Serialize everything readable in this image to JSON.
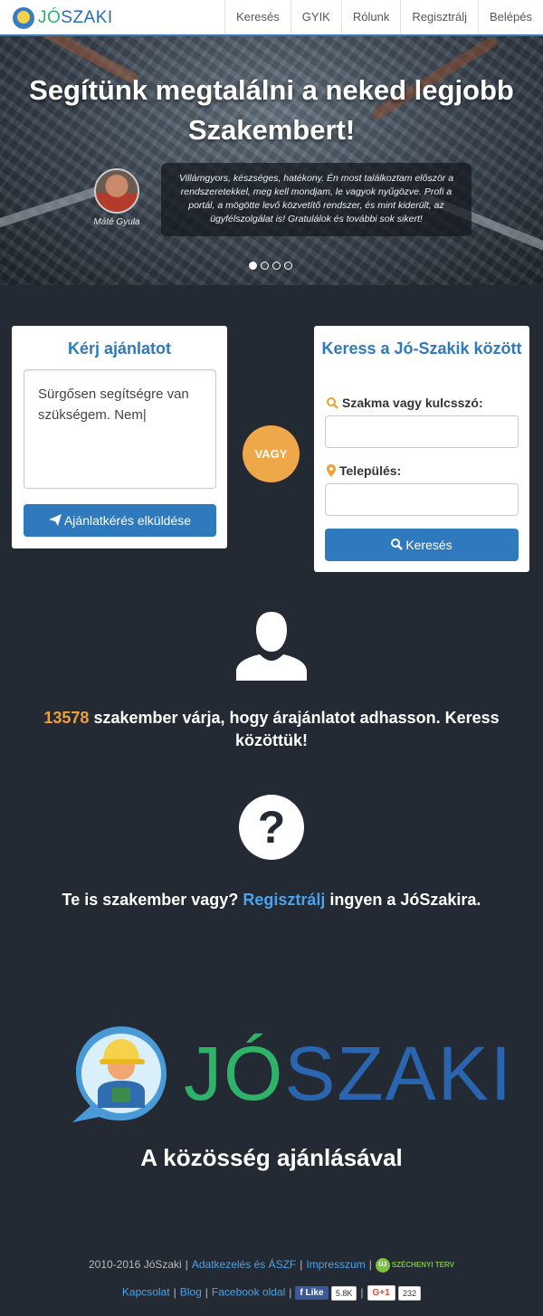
{
  "brand": {
    "jo": "JÓ",
    "szaki": "SZAKI"
  },
  "nav": {
    "items": [
      {
        "label": "Keresés"
      },
      {
        "label": "GYIK"
      },
      {
        "label": "Rólunk"
      },
      {
        "label": "Regisztrálj"
      },
      {
        "label": "Belépés"
      }
    ]
  },
  "hero": {
    "title": "Segítünk megtalálni a neked legjobb Szakembert!",
    "author": "Máté Gyula",
    "quote": "Villámgyors, készséges, hatékony. Én most találkoztam először a rendszeretekkel, meg kell mondjam, le vagyok nyűgözve. Profi a portál, a mögötte levő közvetítő rendszer, és mint kiderült, az ügyfélszolgálat is! Gratulálok és további sok sikert!",
    "slides_total": 4,
    "active_slide": 1
  },
  "request_card": {
    "title": "Kérj ajánlatot",
    "textarea_value": "Sürgősen segítségre van szükségem. Nem|",
    "button_label": "Ajánlatkérés elküldése"
  },
  "or_label": "VAGY",
  "search_card": {
    "title": "Keress a Jó-Szakik között",
    "keyword_label": "Szakma vagy kulcsszó:",
    "keyword_value": "",
    "city_label": "Település:",
    "city_value": "",
    "button_label": "Keresés"
  },
  "stats": {
    "count": "13578",
    "text": "szakember várja, hogy árajánlatot adhasson. Keress közöttük!"
  },
  "register": {
    "prefix": "Te is szakember vagy? ",
    "link": "Regisztrálj",
    "suffix": " ingyen a JóSzakira."
  },
  "big_logo": {
    "jo": "JÓ",
    "szaki": "SZAKI"
  },
  "tagline": "A közösség ajánlásával",
  "footer": {
    "copyright": "2010-2016 JóSzaki",
    "links_row1": [
      "Adatkezelés és ÁSZF",
      "Impresszum"
    ],
    "szechenyi_badge": "ÚJ",
    "szechenyi": "SZÉCHENYI TERV",
    "links_row2": [
      "Kapcsolat",
      "Blog",
      "Facebook oldal"
    ],
    "fb_like": "Like",
    "fb_count": "5.8K",
    "gplus": "G+1",
    "gplus_count": "232"
  },
  "colors": {
    "brand_blue": "#2f79bd",
    "brand_green": "#2fb36a",
    "accent_orange": "#efa849",
    "background": "#232a33"
  }
}
